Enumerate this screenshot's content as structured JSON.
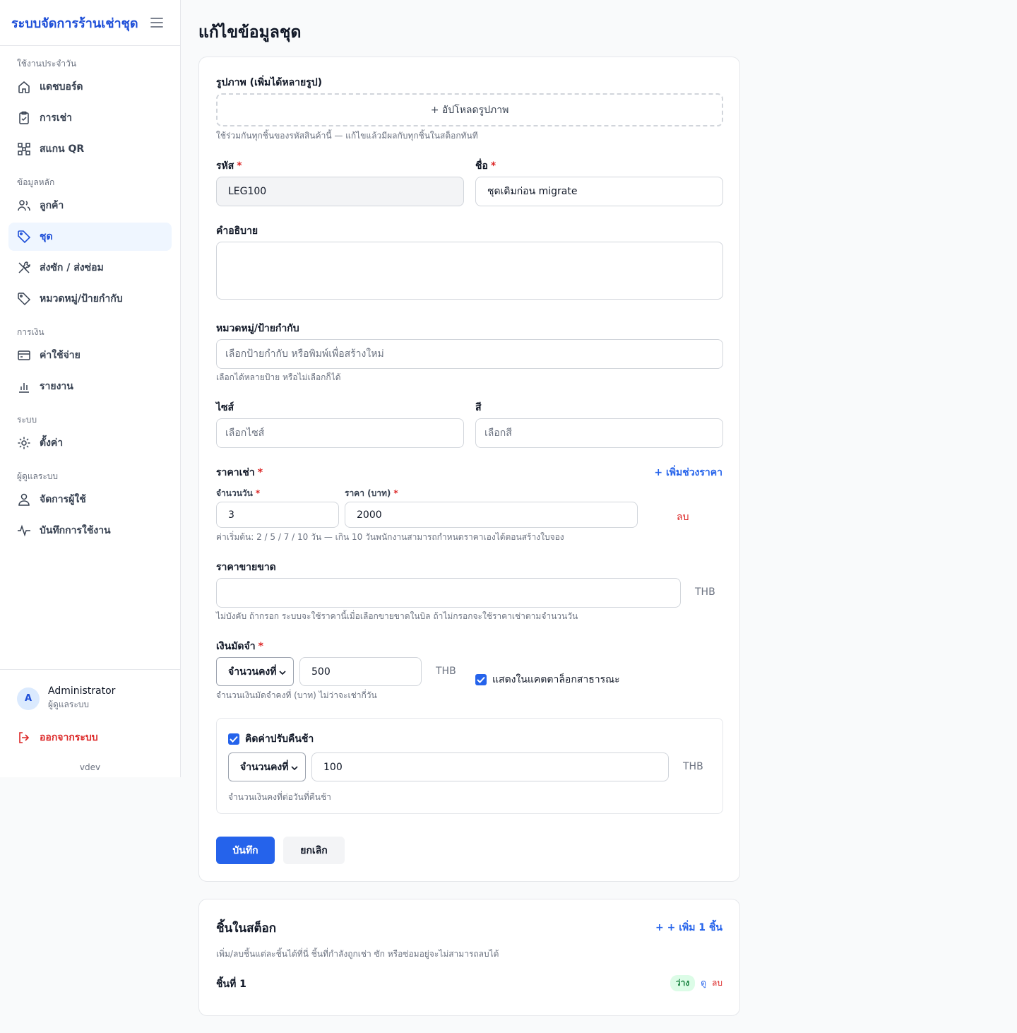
{
  "app": {
    "title": "ระบบจัดการร้านเช่าชุด",
    "version": "vdev"
  },
  "sidebar": {
    "sections": [
      {
        "label": "ใช้งานประจำวัน",
        "items": [
          {
            "label": "แดชบอร์ด",
            "icon": "home-icon"
          },
          {
            "label": "การเช่า",
            "icon": "clipboard-icon"
          },
          {
            "label": "สแกน QR",
            "icon": "qr-scan-icon"
          }
        ]
      },
      {
        "label": "ข้อมูลหลัก",
        "items": [
          {
            "label": "ลูกค้า",
            "icon": "users-icon"
          },
          {
            "label": "ชุด",
            "icon": "tag-icon",
            "active": true
          },
          {
            "label": "ส่งซัก / ส่งซ่อม",
            "icon": "tools-icon"
          },
          {
            "label": "หมวดหมู่/ป้ายกำกับ",
            "icon": "label-icon"
          }
        ]
      },
      {
        "label": "การเงิน",
        "items": [
          {
            "label": "ค่าใช้จ่าย",
            "icon": "credit-card-icon"
          },
          {
            "label": "รายงาน",
            "icon": "bar-chart-icon"
          }
        ]
      },
      {
        "label": "ระบบ",
        "items": [
          {
            "label": "ตั้งค่า",
            "icon": "gear-icon"
          }
        ]
      },
      {
        "label": "ผู้ดูแลระบบ",
        "items": [
          {
            "label": "จัดการผู้ใช้",
            "icon": "user-icon"
          },
          {
            "label": "บันทึกการใช้งาน",
            "icon": "activity-icon"
          }
        ]
      }
    ],
    "user": {
      "initial": "A",
      "name": "Administrator",
      "role": "ผู้ดูแลระบบ"
    },
    "logout_label": "ออกจากระบบ"
  },
  "page": {
    "title": "แก้ไขข้อมูลชุด"
  },
  "form": {
    "images": {
      "label": "รูปภาพ (เพิ่มได้หลายรูป)",
      "upload_label": "+ อัปโหลดรูปภาพ",
      "help": "ใช้ร่วมกันทุกชิ้นของรหัสสินค้านี้ — แก้ไขแล้วมีผลกับทุกชิ้นในสต็อกทันที"
    },
    "code": {
      "label": "รหัส",
      "value": "LEG100"
    },
    "name": {
      "label": "ชื่อ",
      "value": "ชุดเดิมก่อน migrate"
    },
    "description": {
      "label": "คำอธิบาย",
      "value": ""
    },
    "tags": {
      "label": "หมวดหมู่/ป้ายกำกับ",
      "placeholder": "เลือกป้ายกำกับ หรือพิมพ์เพื่อสร้างใหม่",
      "help": "เลือกได้หลายป้าย หรือไม่เลือกก็ได้"
    },
    "size": {
      "label": "ไซส์",
      "placeholder": "เลือกไซส์"
    },
    "color": {
      "label": "สี",
      "placeholder": "เลือกสี"
    },
    "rental_price": {
      "label": "ราคาเช่า",
      "add_tier_label": "+ เพิ่มช่วงราคา",
      "days_label": "จำนวนวัน",
      "price_label": "ราคา (บาท)",
      "tiers": [
        {
          "days": "3",
          "price": "2000",
          "delete_label": "ลบ"
        }
      ],
      "help": "ค่าเริ่มต้น: 2 / 5 / 7 / 10 วัน — เกิน 10 วันพนักงานสามารถกำหนดราคาเองได้ตอนสร้างใบจอง"
    },
    "sale_price": {
      "label": "ราคาขายขาด",
      "value": "",
      "unit": "THB",
      "help": "ไม่บังคับ ถ้ากรอก ระบบจะใช้ราคานี้เมื่อเลือกขายขาดในบิล ถ้าไม่กรอกจะใช้ราคาเช่าตามจำนวนวัน"
    },
    "deposit": {
      "label": "เงินมัดจำ",
      "mode": "จำนวนคงที่",
      "value": "500",
      "unit": "THB",
      "help": "จำนวนเงินมัดจำคงที่ (บาท) ไม่ว่าจะเช่ากี่วัน"
    },
    "show_in_catalog": {
      "label": "แสดงในแคตตาล็อกสาธารณะ",
      "checked": true
    },
    "late_fee": {
      "label": "คิดค่าปรับคืนช้า",
      "checked": true,
      "mode": "จำนวนคงที่",
      "value": "100",
      "unit": "THB",
      "help": "จำนวนเงินคงที่ต่อวันที่คืนช้า"
    },
    "save_label": "บันทึก",
    "cancel_label": "ยกเลิก"
  },
  "stock": {
    "title": "ชิ้นในสต็อก",
    "add_label": "+ + เพิ่ม 1 ชิ้น",
    "help": "เพิ่ม/ลบชิ้นแต่ละชิ้นได้ที่นี่ ชิ้นที่กำลังถูกเช่า ซัก หรือซ่อมอยู่จะไม่สามารถลบได้",
    "items": [
      {
        "label": "ชิ้นที่ 1",
        "status": "ว่าง",
        "view_label": "ดู",
        "delete_label": "ลบ"
      }
    ]
  },
  "colors": {
    "accent": "#2563eb",
    "danger": "#dc2626",
    "brand": "#1d4ed8"
  }
}
